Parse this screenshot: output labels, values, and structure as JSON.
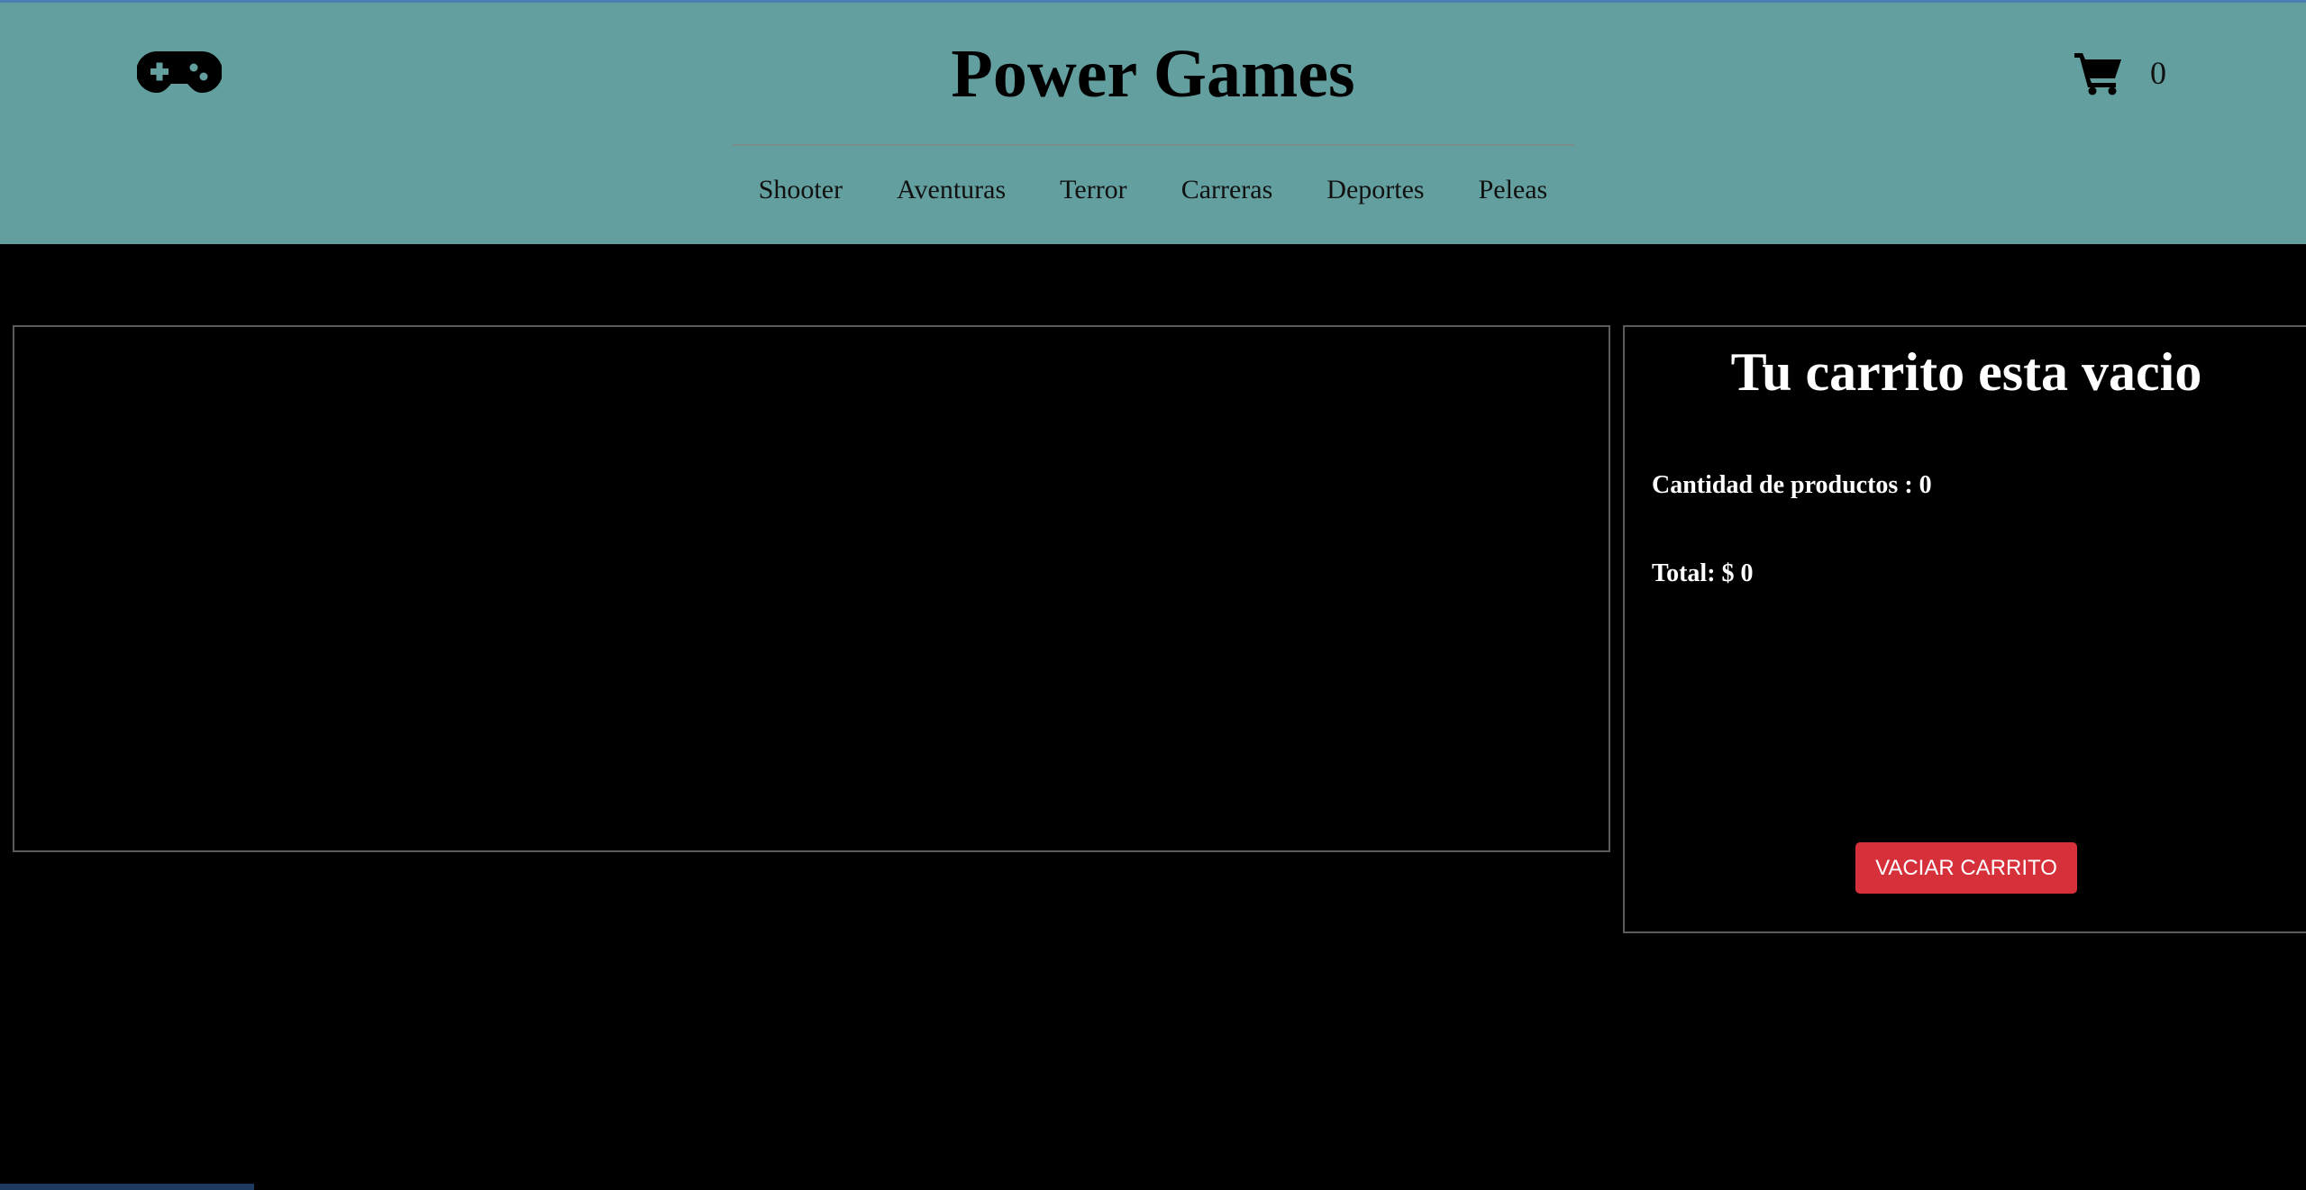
{
  "header": {
    "title": "Power Games",
    "logo_icon": "gamepad-icon",
    "cart_icon": "cart-icon",
    "cart_count": "0",
    "bg_color": "#639f9f",
    "nav": [
      {
        "label": "Shooter"
      },
      {
        "label": "Aventuras"
      },
      {
        "label": "Terror"
      },
      {
        "label": "Carreras"
      },
      {
        "label": "Deportes"
      },
      {
        "label": "Peleas"
      }
    ]
  },
  "cart": {
    "title": "Tu carrito esta vacio",
    "quantity_text": "Cantidad de productos : 0",
    "total_text": "Total: $ 0",
    "empty_button_label": "VACIAR CARRITO",
    "button_color": "#d6313a"
  }
}
